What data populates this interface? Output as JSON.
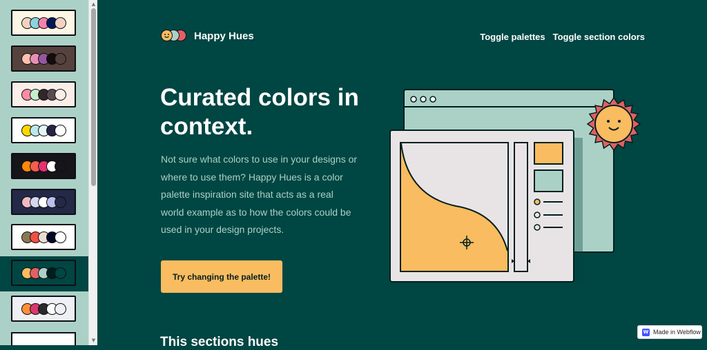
{
  "brand": {
    "name": "Happy Hues",
    "logo_colors": [
      "#f9bc60",
      "#abd1c6",
      "#e16162"
    ]
  },
  "nav": {
    "toggle_palettes": "Toggle palettes",
    "toggle_section_colors": "Toggle section colors"
  },
  "hero": {
    "title": "Curated colors in context.",
    "description": "Not sure what colors to use in your designs or where to use them? Happy Hues is a color palette inspiration site that acts as a real world example as to how the colors could be used in your design projects.",
    "cta_label": "Try changing the palette!"
  },
  "section_heading": "This sections hues",
  "sidebar": {
    "active_index": 7,
    "palettes": [
      {
        "bg": "#fef6e4",
        "colors": [
          "#f3d2c1",
          "#8bd3dd",
          "#f582ae",
          "#001858",
          "#f3d2c1"
        ]
      },
      {
        "bg": "#55423d",
        "colors": [
          "#ffc0ad",
          "#e78fb3",
          "#9656a1",
          "#140d0b",
          "#55423d"
        ]
      },
      {
        "bg": "#faeee7",
        "colors": [
          "#ff8ba7",
          "#c3f0ca",
          "#33272a",
          "#594a4e",
          "#faeee7"
        ]
      },
      {
        "bg": "#fffffe",
        "colors": [
          "#ffd803",
          "#bae8e8",
          "#e3f6f5",
          "#272343",
          "#fffffe"
        ]
      },
      {
        "bg": "#16161a",
        "colors": [
          "#ff8906",
          "#f25f4c",
          "#e53170",
          "#fffffe",
          "#16161a"
        ]
      },
      {
        "bg": "#232946",
        "colors": [
          "#eebbc3",
          "#d4d8f0",
          "#fffffe",
          "#b8c1ec",
          "#232946"
        ]
      },
      {
        "bg": "#fffffe",
        "colors": [
          "#8c7851",
          "#f25042",
          "#eaddcf",
          "#020826",
          "#fffffe"
        ]
      },
      {
        "bg": "#004643",
        "colors": [
          "#f9bc60",
          "#e16162",
          "#abd1c6",
          "#001e1d",
          "#004643"
        ]
      },
      {
        "bg": "#eff0f3",
        "colors": [
          "#ff8e3c",
          "#d9376e",
          "#2a2a2a",
          "#fffffe",
          "#eff0f3"
        ]
      }
    ]
  },
  "badge": {
    "label": "Made in Webflow",
    "icon": "W"
  },
  "colors": {
    "background": "#004643",
    "headline": "#fffffe",
    "paragraph": "#abd1c6",
    "button": "#f9bc60",
    "button_text": "#001e1d",
    "secondary": "#abd1c6",
    "tertiary": "#e16162",
    "stroke": "#001e1d"
  }
}
